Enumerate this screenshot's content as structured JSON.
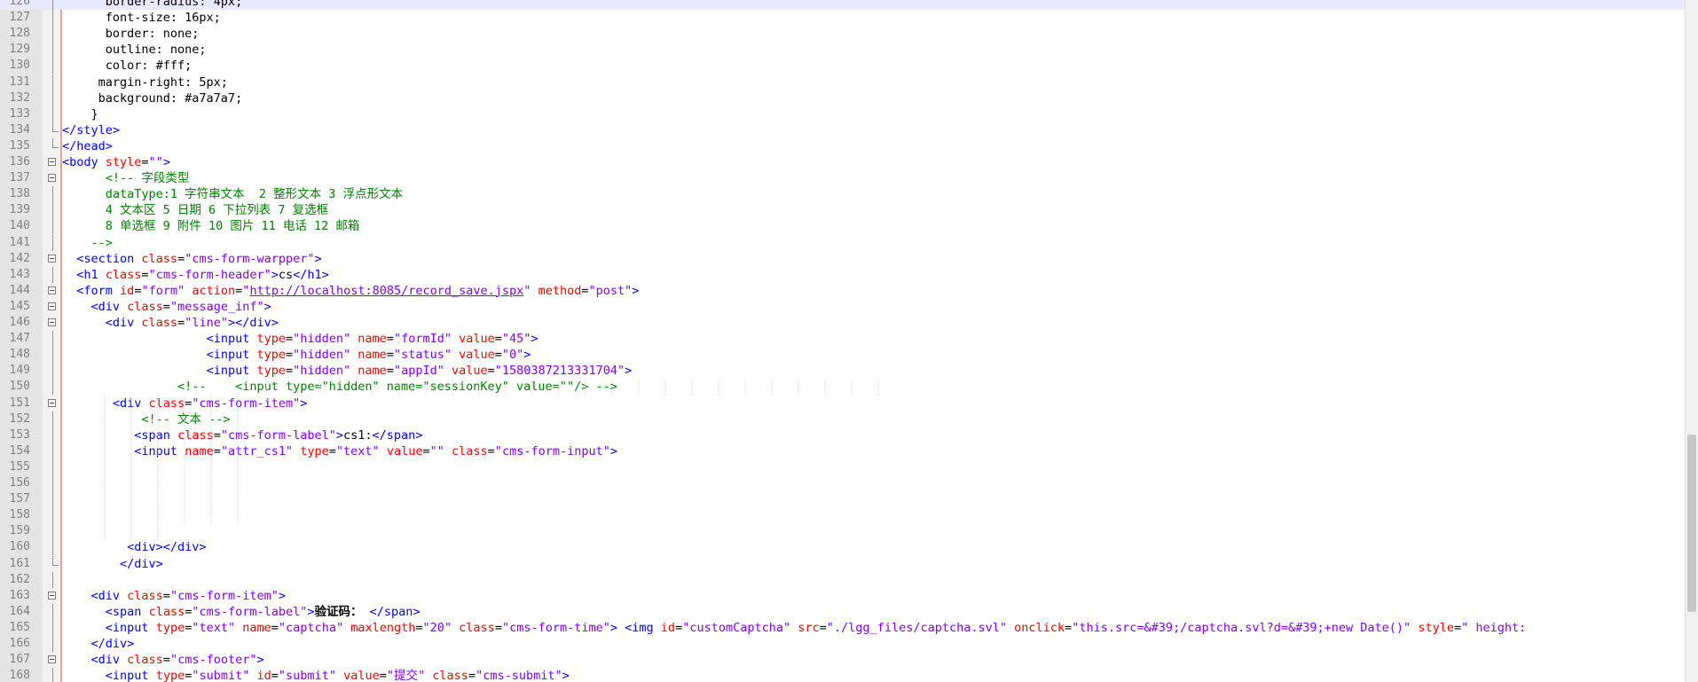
{
  "editor": {
    "current_line": "126",
    "lines": [
      {
        "n": "126",
        "tokens": [
          {
            "c": "text",
            "t": "      border-radius: 4px;"
          }
        ]
      },
      {
        "n": "127",
        "tokens": [
          {
            "c": "text",
            "t": "      font-size: 16px;"
          }
        ]
      },
      {
        "n": "128",
        "tokens": [
          {
            "c": "text",
            "t": "      border: none;"
          }
        ]
      },
      {
        "n": "129",
        "tokens": [
          {
            "c": "text",
            "t": "      outline: none;"
          }
        ]
      },
      {
        "n": "130",
        "tokens": [
          {
            "c": "text",
            "t": "      color: #fff;"
          }
        ]
      },
      {
        "n": "131",
        "tokens": [
          {
            "c": "text",
            "t": "     margin-right: 5px;"
          }
        ]
      },
      {
        "n": "132",
        "tokens": [
          {
            "c": "text",
            "t": "     background: #a7a7a7;"
          }
        ]
      },
      {
        "n": "133",
        "tokens": [
          {
            "c": "text",
            "t": "    }"
          }
        ]
      },
      {
        "n": "134",
        "tokens": [
          {
            "c": "tag",
            "t": "</style>"
          }
        ]
      },
      {
        "n": "135",
        "tokens": [
          {
            "c": "tag",
            "t": "</head>"
          }
        ]
      },
      {
        "n": "136",
        "tokens": [
          {
            "c": "tag",
            "t": "<body "
          },
          {
            "c": "attr",
            "t": "style"
          },
          {
            "c": "text",
            "t": "="
          },
          {
            "c": "val",
            "t": "\"\""
          },
          {
            "c": "tag",
            "t": ">"
          }
        ]
      },
      {
        "n": "137",
        "tokens": [
          {
            "c": "comment",
            "t": "      <!-- 字段类型"
          }
        ]
      },
      {
        "n": "138",
        "tokens": [
          {
            "c": "comment",
            "t": "      dataType:1 字符串文本  2 整形文本 3 浮点形文本"
          }
        ]
      },
      {
        "n": "139",
        "tokens": [
          {
            "c": "comment",
            "t": "      4 文本区 5 日期 6 下拉列表 7 复选框"
          }
        ]
      },
      {
        "n": "140",
        "tokens": [
          {
            "c": "comment",
            "t": "      8 单选框 9 附件 10 图片 11 电话 12 邮箱"
          }
        ]
      },
      {
        "n": "141",
        "tokens": [
          {
            "c": "comment",
            "t": "    -->"
          }
        ]
      },
      {
        "n": "142",
        "tokens": [
          {
            "c": "text",
            "t": "  "
          },
          {
            "c": "tag",
            "t": "<section "
          },
          {
            "c": "attr",
            "t": "class"
          },
          {
            "c": "text",
            "t": "="
          },
          {
            "c": "val",
            "t": "\"cms-form-warpper\""
          },
          {
            "c": "tag",
            "t": ">"
          }
        ]
      },
      {
        "n": "143",
        "tokens": [
          {
            "c": "text",
            "t": "  "
          },
          {
            "c": "tag",
            "t": "<h1 "
          },
          {
            "c": "attr",
            "t": "class"
          },
          {
            "c": "text",
            "t": "="
          },
          {
            "c": "val",
            "t": "\"cms-form-header\""
          },
          {
            "c": "tag",
            "t": ">"
          },
          {
            "c": "text",
            "t": "cs"
          },
          {
            "c": "tag",
            "t": "</h1>"
          }
        ]
      },
      {
        "n": "144",
        "tokens": [
          {
            "c": "text",
            "t": "  "
          },
          {
            "c": "tag",
            "t": "<form "
          },
          {
            "c": "attr",
            "t": "id"
          },
          {
            "c": "text",
            "t": "="
          },
          {
            "c": "val",
            "t": "\"form\""
          },
          {
            "c": "text",
            "t": " "
          },
          {
            "c": "attr",
            "t": "action"
          },
          {
            "c": "text",
            "t": "="
          },
          {
            "c": "val",
            "t": "\""
          },
          {
            "c": "url",
            "t": "http://localhost:8085/record_save.jspx"
          },
          {
            "c": "val",
            "t": "\""
          },
          {
            "c": "text",
            "t": " "
          },
          {
            "c": "attr",
            "t": "method"
          },
          {
            "c": "text",
            "t": "="
          },
          {
            "c": "val",
            "t": "\"post\""
          },
          {
            "c": "tag",
            "t": ">"
          }
        ]
      },
      {
        "n": "145",
        "tokens": [
          {
            "c": "text",
            "t": "    "
          },
          {
            "c": "tag",
            "t": "<div "
          },
          {
            "c": "attr",
            "t": "class"
          },
          {
            "c": "text",
            "t": "="
          },
          {
            "c": "val",
            "t": "\"message_inf\""
          },
          {
            "c": "tag",
            "t": ">"
          }
        ]
      },
      {
        "n": "146",
        "tokens": [
          {
            "c": "text",
            "t": "      "
          },
          {
            "c": "tag",
            "t": "<div "
          },
          {
            "c": "attr",
            "t": "class"
          },
          {
            "c": "text",
            "t": "="
          },
          {
            "c": "val",
            "t": "\"line\""
          },
          {
            "c": "tag",
            "t": "></div>"
          }
        ]
      },
      {
        "n": "147",
        "tokens": [
          {
            "c": "text",
            "t": "                    "
          },
          {
            "c": "tag",
            "t": "<input "
          },
          {
            "c": "attr",
            "t": "type"
          },
          {
            "c": "text",
            "t": "="
          },
          {
            "c": "val",
            "t": "\"hidden\""
          },
          {
            "c": "text",
            "t": " "
          },
          {
            "c": "attr",
            "t": "name"
          },
          {
            "c": "text",
            "t": "="
          },
          {
            "c": "val",
            "t": "\"formId\""
          },
          {
            "c": "text",
            "t": " "
          },
          {
            "c": "attr",
            "t": "value"
          },
          {
            "c": "text",
            "t": "="
          },
          {
            "c": "val",
            "t": "\"45\""
          },
          {
            "c": "tag",
            "t": ">"
          }
        ]
      },
      {
        "n": "148",
        "tokens": [
          {
            "c": "text",
            "t": "                    "
          },
          {
            "c": "tag",
            "t": "<input "
          },
          {
            "c": "attr",
            "t": "type"
          },
          {
            "c": "text",
            "t": "="
          },
          {
            "c": "val",
            "t": "\"hidden\""
          },
          {
            "c": "text",
            "t": " "
          },
          {
            "c": "attr",
            "t": "name"
          },
          {
            "c": "text",
            "t": "="
          },
          {
            "c": "val",
            "t": "\"status\""
          },
          {
            "c": "text",
            "t": " "
          },
          {
            "c": "attr",
            "t": "value"
          },
          {
            "c": "text",
            "t": "="
          },
          {
            "c": "val",
            "t": "\"0\""
          },
          {
            "c": "tag",
            "t": ">"
          }
        ]
      },
      {
        "n": "149",
        "tokens": [
          {
            "c": "text",
            "t": "                    "
          },
          {
            "c": "tag",
            "t": "<input "
          },
          {
            "c": "attr",
            "t": "type"
          },
          {
            "c": "text",
            "t": "="
          },
          {
            "c": "val",
            "t": "\"hidden\""
          },
          {
            "c": "text",
            "t": " "
          },
          {
            "c": "attr",
            "t": "name"
          },
          {
            "c": "text",
            "t": "="
          },
          {
            "c": "val",
            "t": "\"appId\""
          },
          {
            "c": "text",
            "t": " "
          },
          {
            "c": "attr",
            "t": "value"
          },
          {
            "c": "text",
            "t": "="
          },
          {
            "c": "val",
            "t": "\"1580387213331704\""
          },
          {
            "c": "tag",
            "t": ">"
          }
        ]
      },
      {
        "n": "150",
        "tokens": [
          {
            "c": "comment",
            "t": "                <!--    <input type=\"hidden\" name=\"sessionKey\" value=\"\"/> -->"
          }
        ]
      },
      {
        "n": "151",
        "tokens": [
          {
            "c": "text",
            "t": "       "
          },
          {
            "c": "tag",
            "t": "<div "
          },
          {
            "c": "attr",
            "t": "class"
          },
          {
            "c": "text",
            "t": "="
          },
          {
            "c": "val",
            "t": "\"cms-form-item\""
          },
          {
            "c": "tag",
            "t": ">"
          }
        ]
      },
      {
        "n": "152",
        "tokens": [
          {
            "c": "comment",
            "t": "           <!-- 文本 -->"
          }
        ]
      },
      {
        "n": "153",
        "tokens": [
          {
            "c": "text",
            "t": "          "
          },
          {
            "c": "tag",
            "t": "<span "
          },
          {
            "c": "attr",
            "t": "class"
          },
          {
            "c": "text",
            "t": "="
          },
          {
            "c": "val",
            "t": "\"cms-form-label\""
          },
          {
            "c": "tag",
            "t": ">"
          },
          {
            "c": "text",
            "t": "cs1:"
          },
          {
            "c": "tag",
            "t": "</span>"
          }
        ]
      },
      {
        "n": "154",
        "tokens": [
          {
            "c": "text",
            "t": "          "
          },
          {
            "c": "tag",
            "t": "<input "
          },
          {
            "c": "attr",
            "t": "name"
          },
          {
            "c": "text",
            "t": "="
          },
          {
            "c": "val",
            "t": "\"attr_cs1\""
          },
          {
            "c": "text",
            "t": " "
          },
          {
            "c": "attr",
            "t": "type"
          },
          {
            "c": "text",
            "t": "="
          },
          {
            "c": "val",
            "t": "\"text\""
          },
          {
            "c": "text",
            "t": " "
          },
          {
            "c": "attr",
            "t": "value"
          },
          {
            "c": "text",
            "t": "="
          },
          {
            "c": "val",
            "t": "\"\""
          },
          {
            "c": "text",
            "t": " "
          },
          {
            "c": "attr",
            "t": "class"
          },
          {
            "c": "text",
            "t": "="
          },
          {
            "c": "val",
            "t": "\"cms-form-input\""
          },
          {
            "c": "tag",
            "t": ">"
          }
        ]
      },
      {
        "n": "155",
        "tokens": []
      },
      {
        "n": "156",
        "tokens": []
      },
      {
        "n": "157",
        "tokens": []
      },
      {
        "n": "158",
        "tokens": []
      },
      {
        "n": "159",
        "tokens": []
      },
      {
        "n": "160",
        "tokens": [
          {
            "c": "text",
            "t": "         "
          },
          {
            "c": "tag",
            "t": "<div></div>"
          }
        ]
      },
      {
        "n": "161",
        "tokens": [
          {
            "c": "text",
            "t": "        "
          },
          {
            "c": "tag",
            "t": "</div>"
          }
        ]
      },
      {
        "n": "162",
        "tokens": []
      },
      {
        "n": "163",
        "tokens": [
          {
            "c": "text",
            "t": "    "
          },
          {
            "c": "tag",
            "t": "<div "
          },
          {
            "c": "attr",
            "t": "class"
          },
          {
            "c": "text",
            "t": "="
          },
          {
            "c": "val",
            "t": "\"cms-form-item\""
          },
          {
            "c": "tag",
            "t": ">"
          }
        ]
      },
      {
        "n": "164",
        "tokens": [
          {
            "c": "text",
            "t": "      "
          },
          {
            "c": "tag",
            "t": "<span "
          },
          {
            "c": "attr",
            "t": "class"
          },
          {
            "c": "text",
            "t": "="
          },
          {
            "c": "val",
            "t": "\"cms-form-label\""
          },
          {
            "c": "tag",
            "t": ">"
          },
          {
            "c": "bold",
            "t": "验证码："
          },
          {
            "c": "text",
            "t": " "
          },
          {
            "c": "tag",
            "t": "</span>"
          }
        ]
      },
      {
        "n": "165",
        "tokens": [
          {
            "c": "text",
            "t": "      "
          },
          {
            "c": "tag",
            "t": "<input "
          },
          {
            "c": "attr",
            "t": "type"
          },
          {
            "c": "text",
            "t": "="
          },
          {
            "c": "val",
            "t": "\"text\""
          },
          {
            "c": "text",
            "t": " "
          },
          {
            "c": "attr",
            "t": "name"
          },
          {
            "c": "text",
            "t": "="
          },
          {
            "c": "val",
            "t": "\"captcha\""
          },
          {
            "c": "text",
            "t": " "
          },
          {
            "c": "attr",
            "t": "maxlength"
          },
          {
            "c": "text",
            "t": "="
          },
          {
            "c": "val",
            "t": "\"20\""
          },
          {
            "c": "text",
            "t": " "
          },
          {
            "c": "attr",
            "t": "class"
          },
          {
            "c": "text",
            "t": "="
          },
          {
            "c": "val",
            "t": "\"cms-form-time\""
          },
          {
            "c": "tag",
            "t": ">"
          },
          {
            "c": "text",
            "t": " "
          },
          {
            "c": "tag",
            "t": "<img "
          },
          {
            "c": "attr",
            "t": "id"
          },
          {
            "c": "text",
            "t": "="
          },
          {
            "c": "val",
            "t": "\"customCaptcha\""
          },
          {
            "c": "text",
            "t": " "
          },
          {
            "c": "attr",
            "t": "src"
          },
          {
            "c": "text",
            "t": "="
          },
          {
            "c": "val",
            "t": "\"./lgg_files/captcha.svl\""
          },
          {
            "c": "text",
            "t": " "
          },
          {
            "c": "attr",
            "t": "onclick"
          },
          {
            "c": "text",
            "t": "="
          },
          {
            "c": "val",
            "t": "\"this.src=&#39;/captcha.svl?d=&#39;+new Date()\""
          },
          {
            "c": "text",
            "t": " "
          },
          {
            "c": "attr",
            "t": "style"
          },
          {
            "c": "text",
            "t": "="
          },
          {
            "c": "val",
            "t": "\" height:"
          }
        ]
      },
      {
        "n": "166",
        "tokens": [
          {
            "c": "text",
            "t": "    "
          },
          {
            "c": "tag",
            "t": "</div>"
          }
        ]
      },
      {
        "n": "167",
        "tokens": [
          {
            "c": "text",
            "t": "    "
          },
          {
            "c": "tag",
            "t": "<div "
          },
          {
            "c": "attr",
            "t": "class"
          },
          {
            "c": "text",
            "t": "="
          },
          {
            "c": "val",
            "t": "\"cms-footer\""
          },
          {
            "c": "tag",
            "t": ">"
          }
        ]
      },
      {
        "n": "168",
        "tokens": [
          {
            "c": "text",
            "t": "      "
          },
          {
            "c": "tag",
            "t": "<input "
          },
          {
            "c": "attr",
            "t": "type"
          },
          {
            "c": "text",
            "t": "="
          },
          {
            "c": "val",
            "t": "\"submit\""
          },
          {
            "c": "text",
            "t": " "
          },
          {
            "c": "attr",
            "t": "id"
          },
          {
            "c": "text",
            "t": "="
          },
          {
            "c": "val",
            "t": "\"submit\""
          },
          {
            "c": "text",
            "t": " "
          },
          {
            "c": "attr",
            "t": "value"
          },
          {
            "c": "text",
            "t": "="
          },
          {
            "c": "val",
            "t": "\"提交\""
          },
          {
            "c": "text",
            "t": " "
          },
          {
            "c": "attr",
            "t": "class"
          },
          {
            "c": "text",
            "t": "="
          },
          {
            "c": "val",
            "t": "\"cms-submit\""
          },
          {
            "c": "tag",
            "t": ">"
          }
        ]
      }
    ],
    "fold_markers": [
      "136",
      "137",
      "142",
      "144",
      "145",
      "146",
      "151",
      "163",
      "167"
    ],
    "fold_ends": [
      "134",
      "135",
      "161"
    ],
    "colors": {
      "tag": "#0000ff",
      "attribute": "#ff0000",
      "value": "#8000ff",
      "comment": "#008000",
      "text": "#000000",
      "gutter": "#e4e4e4",
      "current_line": "#e8e8ff"
    }
  }
}
